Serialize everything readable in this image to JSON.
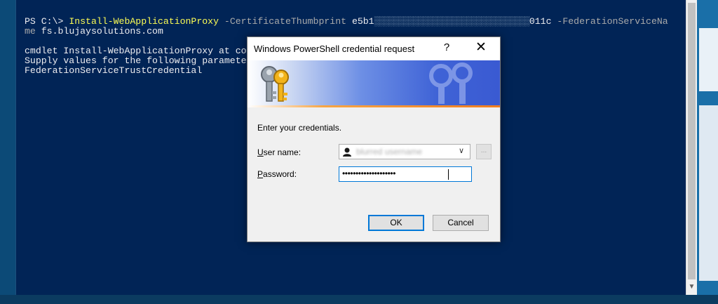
{
  "console": {
    "line1_prompt": "PS C:\\> ",
    "line1_cmd": "Install-WebApplicationProxy",
    "line1_param1": " -CertificateThumbprint ",
    "line1_thumb_start": "e5b1",
    "line1_thumb_end": "011c",
    "line1_param2": " -FederationServiceNa",
    "line2_wrap": "me ",
    "line2_value": "fs.blujaysolutions.com",
    "line4": "cmdlet Install-WebApplicationProxy at cor",
    "line5": "Supply values for the following paramete",
    "line6": "FederationServiceTrustCredential"
  },
  "dialog": {
    "title": "Windows PowerShell credential request",
    "help": "?",
    "close": "✕",
    "prompt": "Enter your credentials.",
    "user_label_first": "U",
    "user_label_rest": "ser name:",
    "password_label_first": "P",
    "password_label_rest": "assword:",
    "user_value": "blurred username",
    "password_value": "••••••••••••••••••••",
    "browse_label": "...",
    "ok_label": "OK",
    "cancel_label": "Cancel"
  },
  "icons": {
    "keys": "keys-icon",
    "user": "user-icon",
    "chevron": "chevron-down-icon",
    "close": "close-icon",
    "help": "help-icon"
  },
  "colors": {
    "console_bg": "#012456",
    "command_yellow": "#fdfd54",
    "focus_blue": "#0078d7"
  }
}
